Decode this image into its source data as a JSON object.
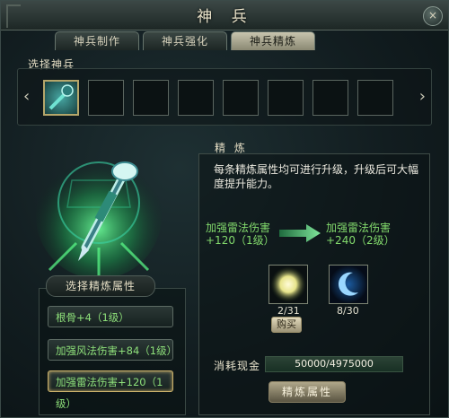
{
  "window": {
    "title": "神 兵",
    "close": "×"
  },
  "tabs": [
    {
      "label": "神兵制作",
      "active": false
    },
    {
      "label": "神兵强化",
      "active": false
    },
    {
      "label": "神兵精炼",
      "active": true
    }
  ],
  "select_weapon": {
    "label": "选择神兵",
    "slots": 8,
    "selected_index": 0,
    "left_arrow": "‹",
    "right_arrow": "›"
  },
  "refine": {
    "heading": "精 炼",
    "description": "每条精炼属性均可进行升级，升级后可大幅度提升能力。",
    "current": {
      "name": "加强雷法伤害",
      "value": "+120（1级）"
    },
    "next": {
      "name": "加强雷法伤害",
      "value": "+240（2级）"
    },
    "materials": [
      {
        "icon": "sun-orb-icon",
        "count": "2/31"
      },
      {
        "icon": "crescent-moon-icon",
        "count": "8/30"
      }
    ],
    "buy_label": "购买",
    "cost_label": "消耗现金",
    "cost_value": "50000/4975000",
    "refine_button": "精炼属性"
  },
  "attributes": {
    "heading": "选择精炼属性",
    "items": [
      {
        "label": "根骨+4（1级）",
        "selected": false
      },
      {
        "label": "加强风法伤害+84（1级）",
        "selected": false
      },
      {
        "label": "加强雷法伤害+120（1级）",
        "selected": true
      }
    ]
  },
  "colors": {
    "accent_green": "#82d96c",
    "gold_border": "#c9b06a",
    "panel_bg": "#121d20"
  }
}
